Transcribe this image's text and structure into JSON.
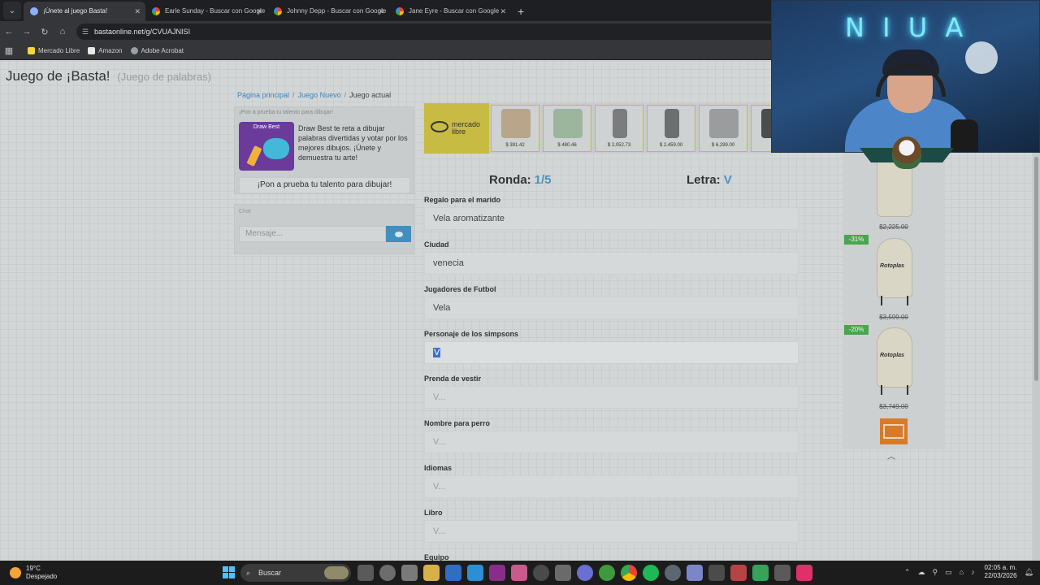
{
  "browser": {
    "tabs": [
      {
        "title": "¡Únete al juego Basta!",
        "active": true,
        "favicon": "basta-favicon"
      },
      {
        "title": "Earle Sunday - Buscar con Google",
        "active": false,
        "favicon": "google-favicon"
      },
      {
        "title": "Johnny Depp - Buscar con Google",
        "active": false,
        "favicon": "google-favicon"
      },
      {
        "title": "Jane Eyre - Buscar con Google",
        "active": false,
        "favicon": "google-favicon"
      }
    ],
    "url": "bastaonline.net/g/CVUAJNISI",
    "bookmarks": [
      "Mercado Libre",
      "Amazon",
      "Adobe Acrobat"
    ]
  },
  "site": {
    "title": "Juego de ¡Basta!",
    "subtitle": "(Juego de palabras)"
  },
  "breadcrumb": {
    "home": "Página principal",
    "new_game": "Juego Nuevo",
    "current": "Juego actual"
  },
  "promo": {
    "title": "¡Pon a prueba tu talento para dibujar!",
    "image_text": "Draw Best",
    "description": "Draw Best te reta a dibujar palabras divertidas y votar por los mejores dibujos. ¡Únete y demuestra tu arte!",
    "button": "¡Pon a prueba tu talento para dibujar!"
  },
  "chat": {
    "label": "Chat",
    "placeholder": "Mensaje..."
  },
  "ad_strip": {
    "brand": "mercado libre",
    "prices": [
      "$ 391.42",
      "$ 480.46",
      "$ 2,052.73",
      "$ 2,459.00",
      "$ 6,299.00",
      "$"
    ]
  },
  "game": {
    "round_label": "Ronda:",
    "round_value": "1/5",
    "letter_label": "Letra:",
    "letter_value": "V",
    "fields": [
      {
        "label": "Regalo para el marido",
        "value": "Vela aromatizante",
        "placeholder": false
      },
      {
        "label": "Ciudad",
        "value": "venecia",
        "placeholder": false
      },
      {
        "label": "Jugadores de Futbol",
        "value": "Vela",
        "placeholder": false
      },
      {
        "label": "Personaje de los simpsons",
        "value": "V",
        "placeholder": false
      },
      {
        "label": "Prenda de vestir",
        "value": "V...",
        "placeholder": true
      },
      {
        "label": "Nombre para perro",
        "value": "V...",
        "placeholder": true
      },
      {
        "label": "Idiomas",
        "value": "V...",
        "placeholder": true
      },
      {
        "label": "Libro",
        "value": "V...",
        "placeholder": true
      },
      {
        "label": "Equipo",
        "value": "",
        "placeholder": true
      }
    ]
  },
  "side_ad": {
    "prices": [
      "$2,225.00",
      "$3,599.00",
      "$3,749.00"
    ],
    "discounts": [
      "-31%",
      "-20%"
    ],
    "tank_brand": "Rotoplas"
  },
  "webcam": {
    "neon_text": "N I U A"
  },
  "taskbar": {
    "temperature": "19°C",
    "weather": "Despejado",
    "search_placeholder": "Buscar",
    "time": "02:05 a. m.",
    "date": "22/03/2026"
  },
  "colors": {
    "accent_blue": "#4b93c3",
    "link_blue": "#3f84b8",
    "send_button": "#3f8fbf",
    "discount_green": "#4aa54f",
    "mercado_yellow": "#c7bb43"
  }
}
